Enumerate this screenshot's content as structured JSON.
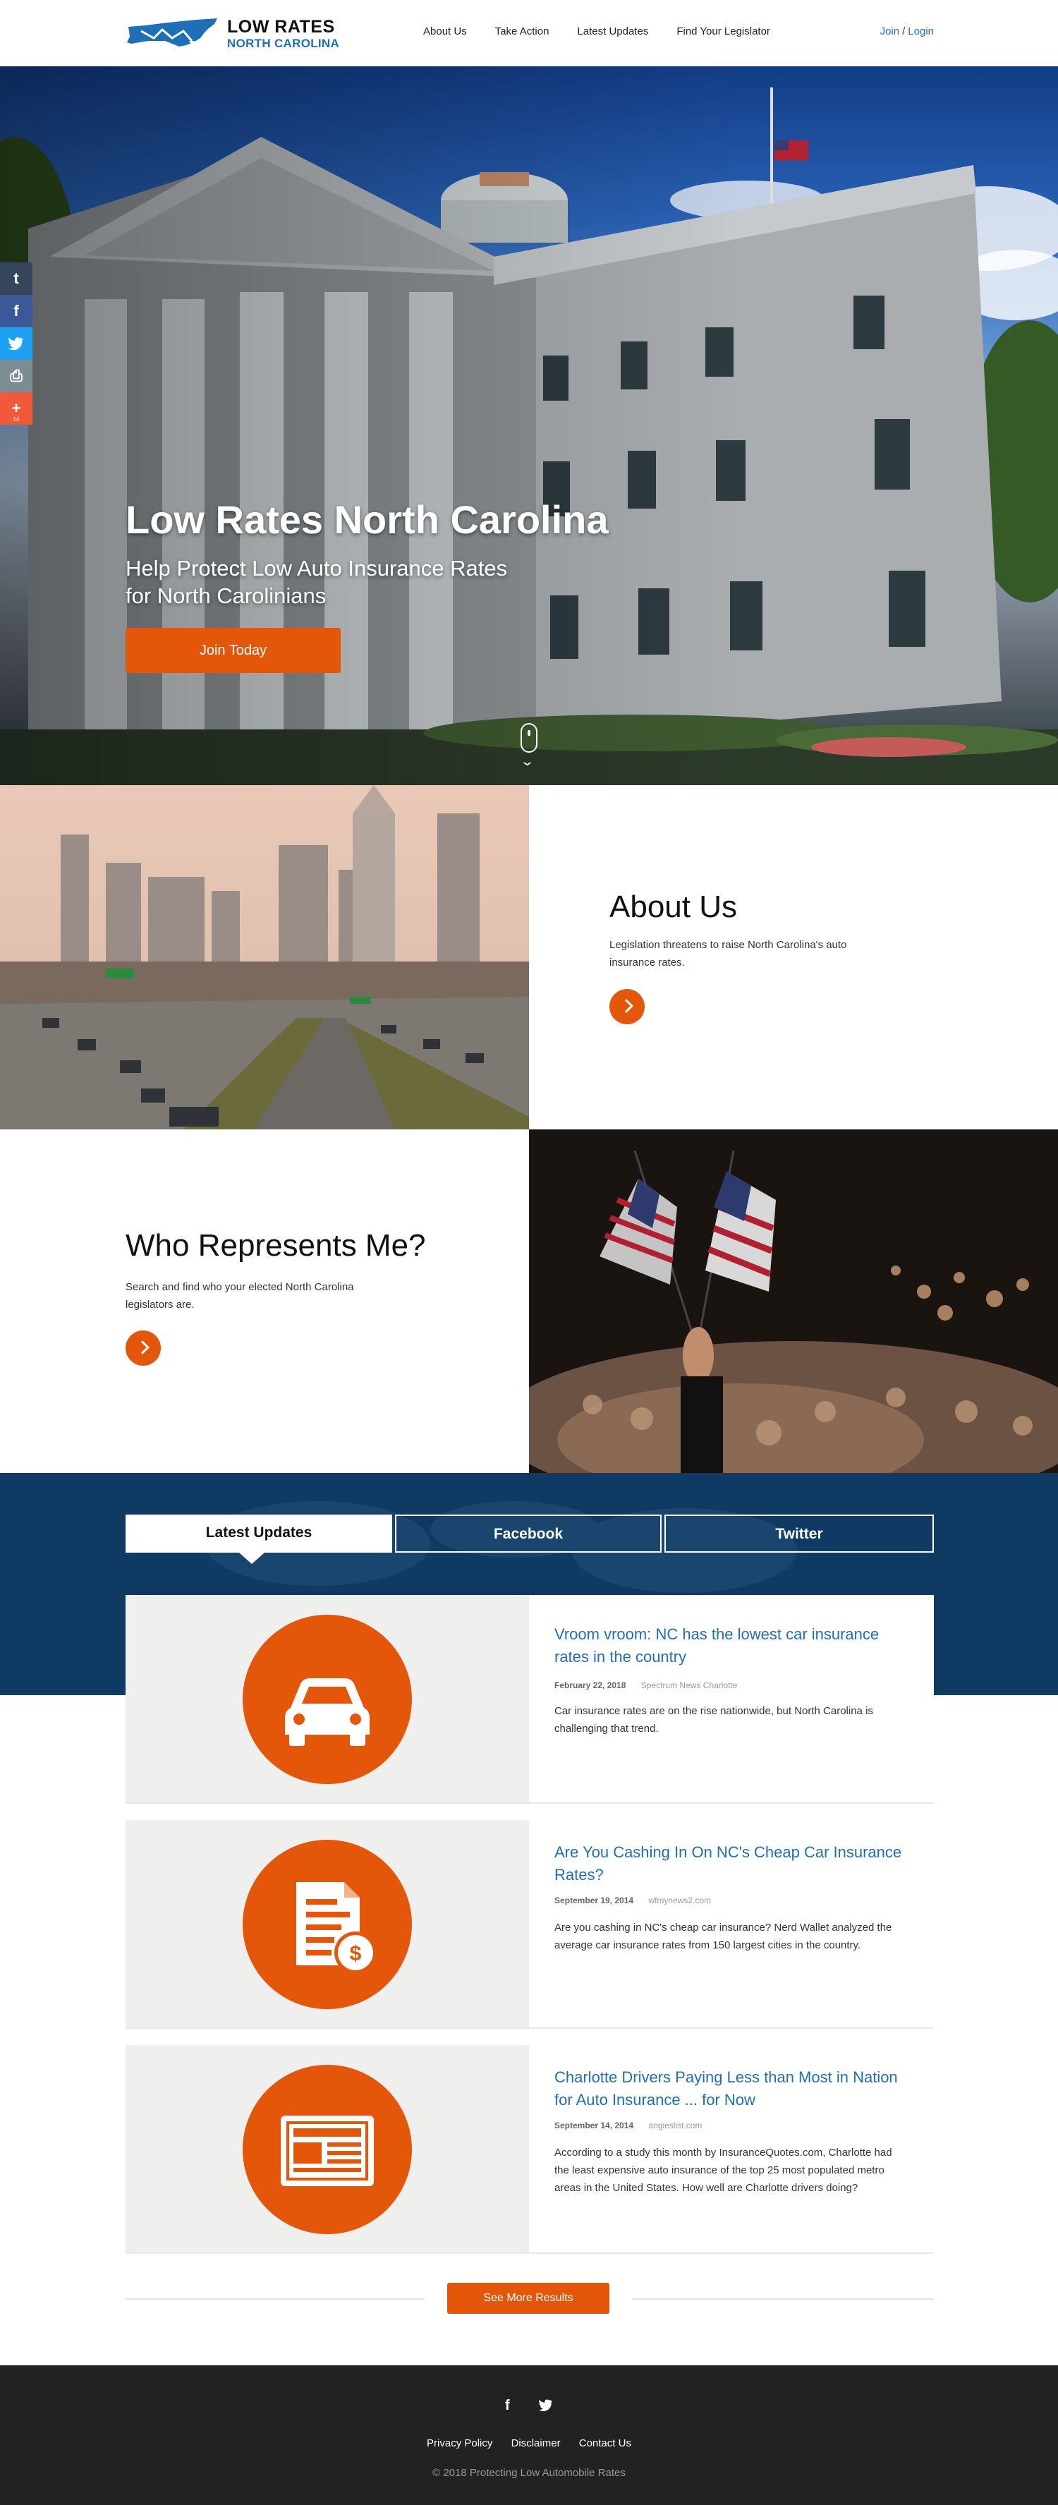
{
  "header": {
    "logo_line1": "LOW RATES",
    "logo_line2": "NORTH CAROLINA",
    "nav": [
      "About Us",
      "Take Action",
      "Latest Updates",
      "Find Your Legislator"
    ],
    "join": "Join",
    "auth_sep": "/",
    "login": "Login"
  },
  "hero": {
    "title": "Low Rates North Carolina",
    "subtitle": "Help Protect Low Auto Insurance Rates for North Carolinians",
    "button": "Join Today"
  },
  "share_bar": {
    "items": [
      {
        "icon": "tumblr-icon",
        "glyph": "t"
      },
      {
        "icon": "facebook-icon",
        "glyph": "f"
      },
      {
        "icon": "twitter-icon",
        "glyph": "🐦"
      },
      {
        "icon": "print-icon",
        "glyph": "⎙"
      },
      {
        "icon": "plus-icon",
        "glyph": "+"
      }
    ],
    "plus_count": "14"
  },
  "about": {
    "title": "About Us",
    "body": "Legislation threatens to raise North Carolina's auto insurance rates."
  },
  "represents": {
    "title": "Who Represents Me?",
    "body": "Search and find who your elected North Carolina legislators are."
  },
  "updates": {
    "tabs": [
      "Latest Updates",
      "Facebook",
      "Twitter"
    ],
    "articles": [
      {
        "icon": "car-icon",
        "title": "Vroom vroom: NC has the lowest car insurance rates in the country",
        "date": "February 22, 2018",
        "source": "Spectrum News Charlotte",
        "description": "Car insurance rates are on the rise nationwide, but North Carolina is challenging that trend."
      },
      {
        "icon": "document-dollar-icon",
        "title": "Are You Cashing In On NC's Cheap Car Insurance Rates?",
        "date": "September 19, 2014",
        "source": "wfmynews2.com",
        "description": "Are you cashing in NC's cheap car insurance? Nerd Wallet analyzed the average car insurance rates from 150 largest cities in the country."
      },
      {
        "icon": "newspaper-icon",
        "title": "Charlotte Drivers Paying Less than Most in Nation for Auto Insurance ... for Now",
        "date": "September 14, 2014",
        "source": "angieslist.com",
        "description": "According to a study this month by InsuranceQuotes.com, Charlotte had the least expensive auto insurance of the top 25 most populated metro areas in the United States. How well are Charlotte drivers doing?"
      }
    ],
    "more_button": "See More Results"
  },
  "footer": {
    "links": [
      "Privacy Policy",
      "Disclaimer",
      "Contact Us"
    ],
    "copyright": "© 2018 Protecting Low Automobile Rates"
  },
  "colors": {
    "accent": "#e4560a",
    "link_blue": "#1f6fb8",
    "band_navy": "#0f3a63",
    "footer": "#222222"
  }
}
